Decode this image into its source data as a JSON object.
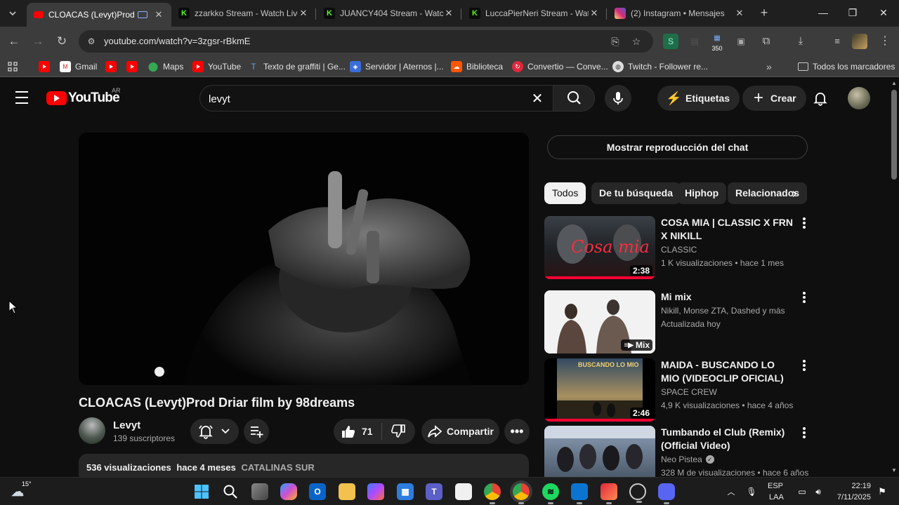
{
  "browser": {
    "tabs": [
      {
        "title": "CLOACAS (Levyt)Prod D",
        "favicon": "youtube-icon",
        "active": true
      },
      {
        "title": "zzarkko Stream - Watch Live",
        "favicon": "kick-icon",
        "active": false
      },
      {
        "title": "JUANCY404 Stream - Watch",
        "favicon": "kick-icon",
        "active": false
      },
      {
        "title": "LuccaPierNeri Stream - Watc",
        "favicon": "kick-icon",
        "active": false
      },
      {
        "title": "(2) Instagram • Mensajes",
        "favicon": "instagram-icon",
        "active": false
      }
    ],
    "url": "youtube.com/watch?v=3zgsr-rBkmE",
    "extension_badge": "350",
    "bookmarks": [
      {
        "label": "",
        "icon": "youtube-icon"
      },
      {
        "label": "Gmail",
        "icon": "gmail-icon"
      },
      {
        "label": "",
        "icon": "youtube-icon"
      },
      {
        "label": "",
        "icon": "youtube-icon"
      },
      {
        "label": "Maps",
        "icon": "maps-icon"
      },
      {
        "label": "YouTube",
        "icon": "youtube-icon"
      },
      {
        "label": "Texto de graffiti | Ge...",
        "icon": "graffiti-icon"
      },
      {
        "label": "Servidor | Aternos |...",
        "icon": "aternos-icon"
      },
      {
        "label": "Biblioteca",
        "icon": "soundcloud-icon"
      },
      {
        "label": "Convertio — Conve...",
        "icon": "convertio-icon"
      },
      {
        "label": "Twitch - Follower re...",
        "icon": "twitch-icon"
      }
    ],
    "all_bookmarks": "Todos los marcadores"
  },
  "masthead": {
    "logo_text": "YouTube",
    "country": "AR",
    "search_value": "levyt",
    "labels_button": "Etiquetas",
    "create_button": "Crear"
  },
  "video": {
    "title": "CLOACAS (Levyt)Prod Driar film by 98dreams",
    "channel": "Levyt",
    "subscribers": "139 suscriptores",
    "likes": "71",
    "share": "Compartir",
    "views": "536 visualizaciones",
    "age": "hace 4 meses",
    "tag": "CATALINAS SUR"
  },
  "sidebar": {
    "chat_button": "Mostrar reproducción del chat",
    "chips": [
      "Todos",
      "De tu búsqueda",
      "Hiphop",
      "Relacionados"
    ],
    "recommendations": [
      {
        "title": "COSA MIA | CLASSIC X FRN X NIKILL",
        "channel": "CLASSIC",
        "meta": "1 K visualizaciones • hace 1 mes",
        "duration": "2:38",
        "thumb_text": "Cosa mia",
        "watched": 1.0
      },
      {
        "title": "Mi mix",
        "channel": "Nikill, Monse ZTA, Dashed y más",
        "meta": "Actualizada hoy",
        "duration": "Mix",
        "thumb_text": "",
        "watched": 0
      },
      {
        "title": "MAIDA - BUSCANDO LO MIO (VIDEOCLIP OFICIAL)",
        "channel": "SPACE CREW",
        "meta": "4,9 K visualizaciones • hace 4 años",
        "duration": "2:46",
        "thumb_text": "BUSCANDO LO MIO",
        "watched": 1.0
      },
      {
        "title": "Tumbando el Club (Remix) (Official Video)",
        "channel": "Neo Pistea",
        "meta": "328 M de visualizaciones • hace 6 años",
        "duration": "",
        "thumb_text": "",
        "watched": 0
      }
    ]
  },
  "taskbar": {
    "weather": "15°",
    "language": "ESP",
    "layout": "LAA",
    "time": "22:19",
    "date": "7/11/2025"
  },
  "colors": {
    "youtube_red": "#ff0000",
    "kick_green": "#53fc18",
    "background": "#0f0f0f",
    "chip_bg": "#272727"
  }
}
